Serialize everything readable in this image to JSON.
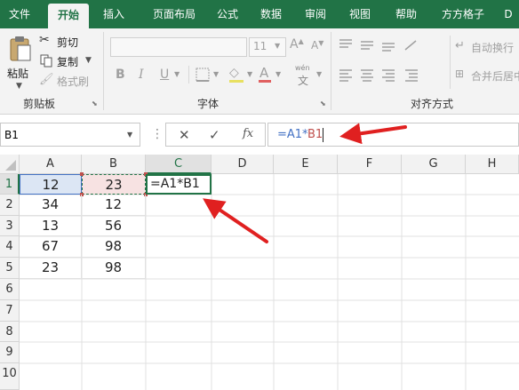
{
  "tabs": [
    "文件",
    "开始",
    "插入",
    "页面布局",
    "公式",
    "数据",
    "审阅",
    "视图",
    "帮助",
    "方方格子",
    "D"
  ],
  "active_tab": "开始",
  "ribbon": {
    "paste_label": "粘贴",
    "cut_label": "剪切",
    "copy_label": "复制",
    "format_painter_label": "格式刷",
    "clipboard_group": "剪贴板",
    "font_size": "11",
    "font_group": "字体",
    "bold": "B",
    "italic": "I",
    "underline": "U",
    "grow_font": "A",
    "shrink_font": "A",
    "wen_label": "wén",
    "wen_char": "文",
    "wrap_text_label": "自动换行",
    "merge_center_label": "合并后居中",
    "alignment_group": "对齐方式"
  },
  "formula_bar": {
    "name_box": "B1",
    "cancel_glyph": "✕",
    "enter_glyph": "✓",
    "fx_label": "fx",
    "formula_part1": "=A1*",
    "formula_part2": "B1"
  },
  "columns": [
    "A",
    "B",
    "C",
    "D",
    "E",
    "F",
    "G",
    "H"
  ],
  "rows": [
    "1",
    "2",
    "3",
    "4",
    "5",
    "6",
    "7",
    "8",
    "9",
    "10"
  ],
  "cells": {
    "A1": "12",
    "B1": "23",
    "C1": "=A1*B1",
    "A2": "34",
    "B2": "12",
    "A3": "13",
    "B3": "56",
    "A4": "67",
    "B4": "98",
    "A5": "23",
    "B5": "98"
  },
  "colors": {
    "excel_green": "#217346",
    "arrow_red": "#e02020",
    "ref_blue": "#4472c4",
    "ref_red": "#c0504d"
  }
}
